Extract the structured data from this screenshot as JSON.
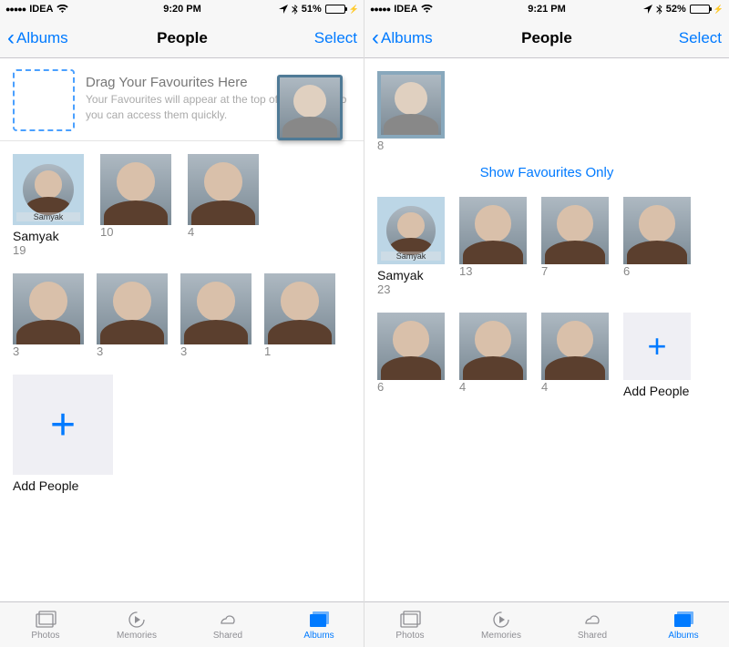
{
  "left": {
    "status": {
      "carrier": "IDEA",
      "time": "9:20 PM",
      "battery": "51%"
    },
    "nav": {
      "back": "Albums",
      "title": "People",
      "select": "Select"
    },
    "fav": {
      "title": "Drag Your Favourites Here",
      "subtitle": "Your Favourites will appear at the top of the album, so you can access them quickly."
    },
    "row1": [
      {
        "name": "Samyak",
        "count": "19",
        "innerlabel": "Samyak"
      },
      {
        "count": "10"
      },
      {
        "count": "4"
      }
    ],
    "row2": [
      {
        "count": "3"
      },
      {
        "count": "3"
      },
      {
        "count": "3"
      },
      {
        "count": "1"
      }
    ],
    "add": "Add People"
  },
  "right": {
    "status": {
      "carrier": "IDEA",
      "time": "9:21 PM",
      "battery": "52%"
    },
    "nav": {
      "back": "Albums",
      "title": "People",
      "select": "Select"
    },
    "favTile": {
      "count": "8"
    },
    "showFav": "Show Favourites Only",
    "row1": [
      {
        "name": "Samyak",
        "count": "23",
        "innerlabel": "Samyak"
      },
      {
        "count": "13"
      },
      {
        "count": "7"
      },
      {
        "count": "6"
      }
    ],
    "row2": [
      {
        "count": "6"
      },
      {
        "count": "4"
      },
      {
        "count": "4"
      }
    ],
    "add": "Add People"
  },
  "tabs": {
    "photos": "Photos",
    "memories": "Memories",
    "shared": "Shared",
    "albums": "Albums"
  }
}
